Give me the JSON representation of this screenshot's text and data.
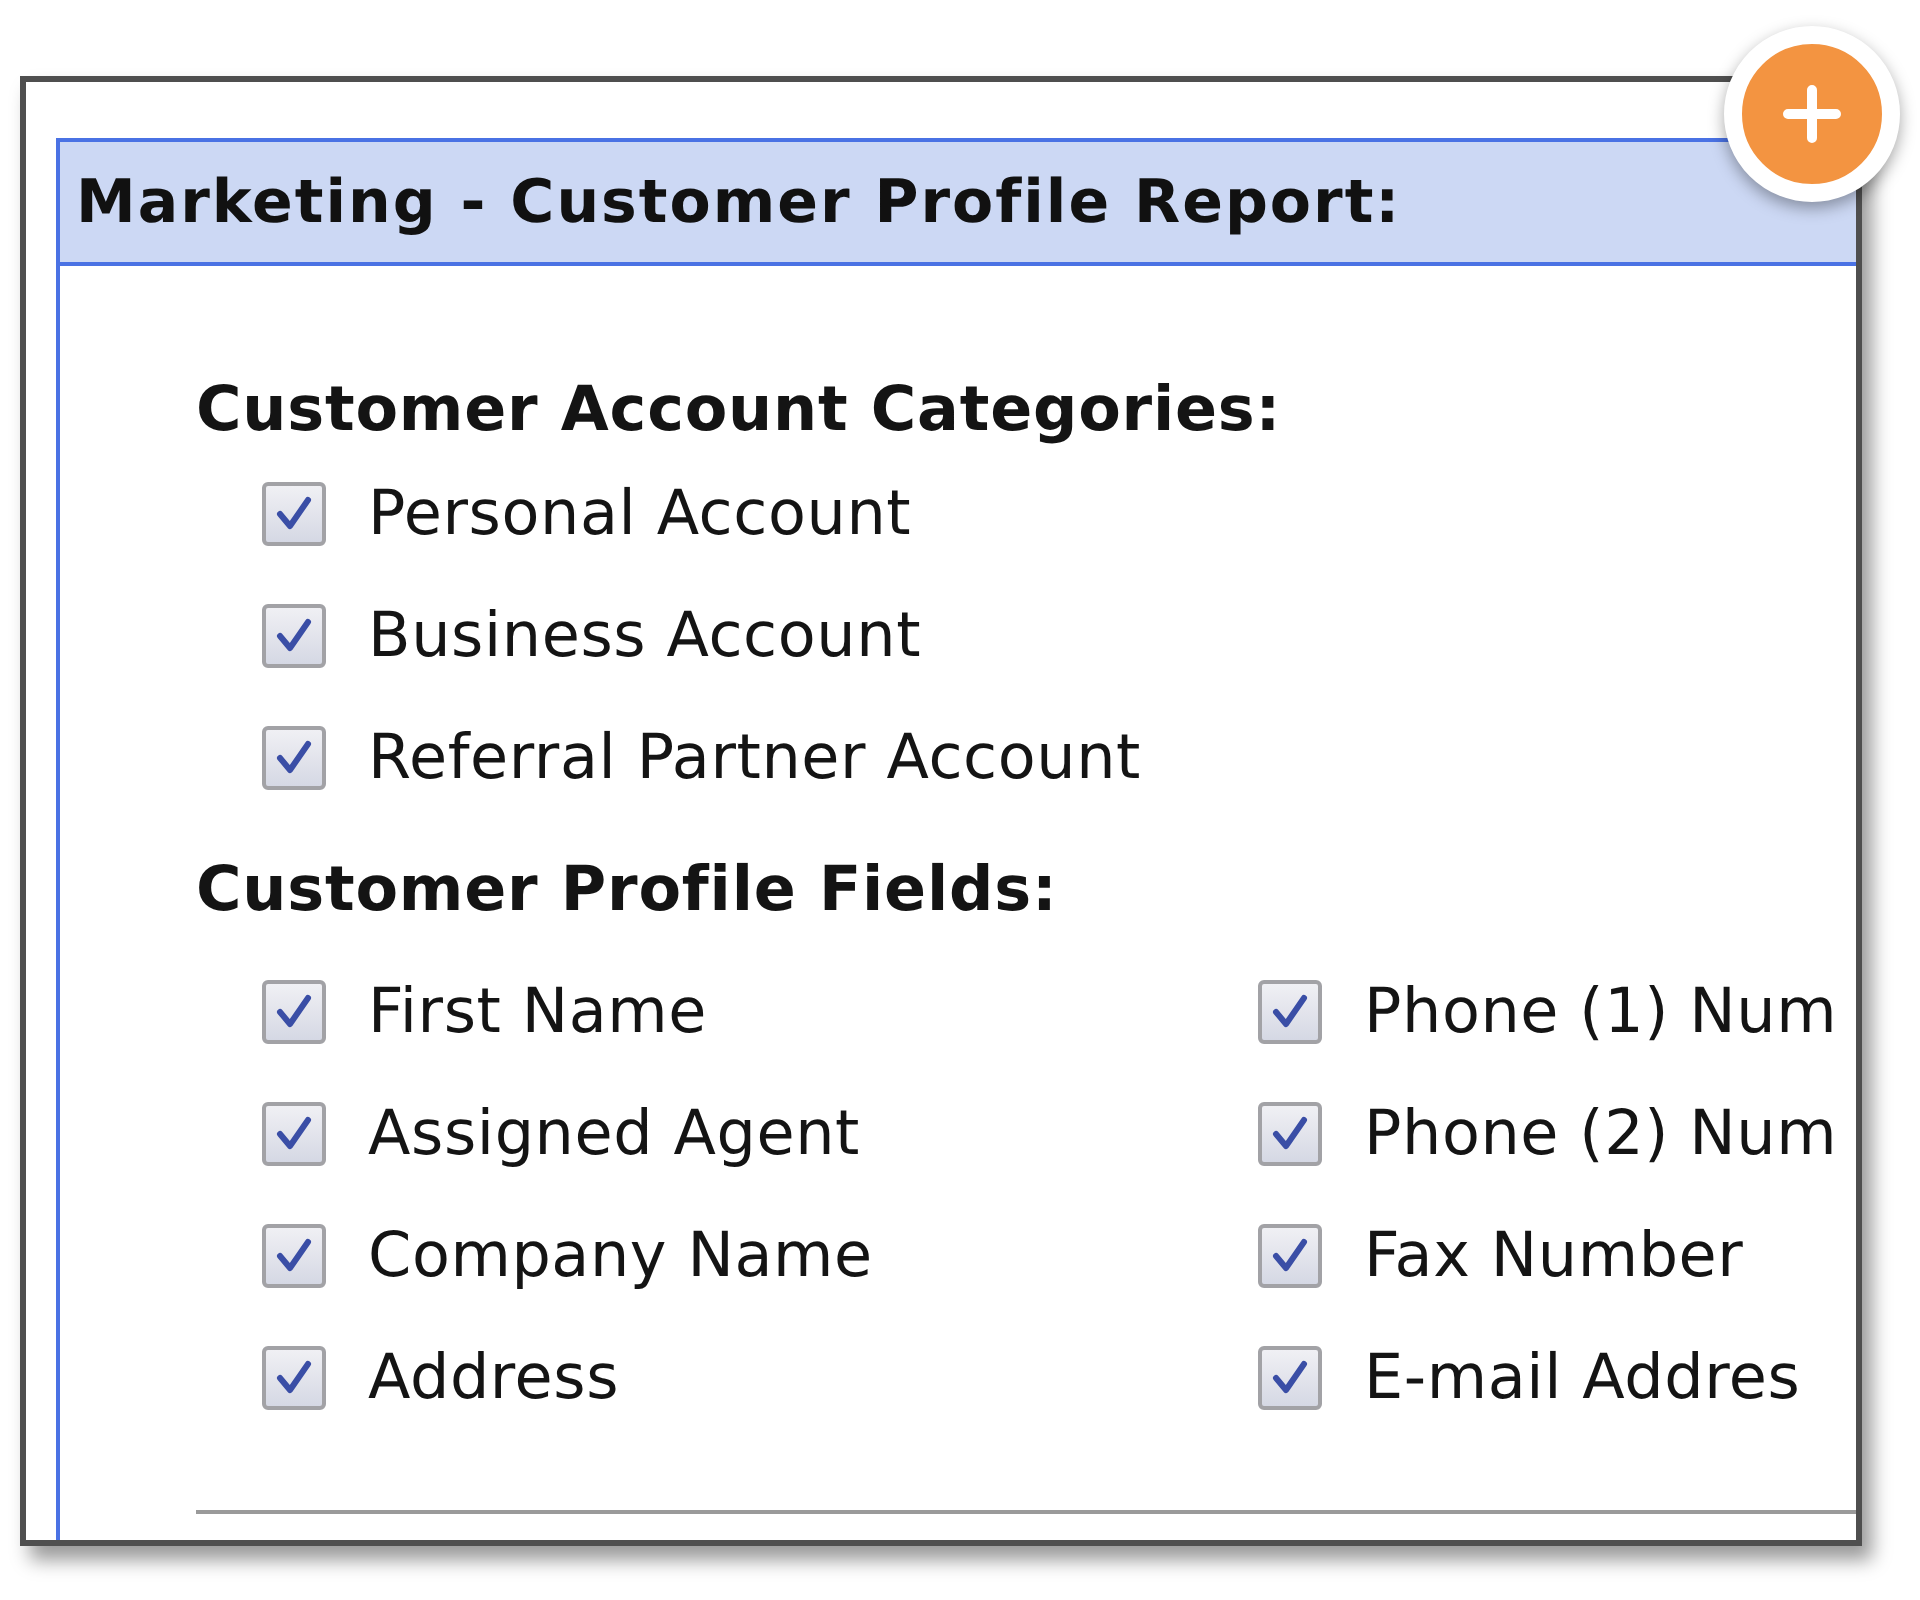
{
  "report": {
    "title": "Marketing - Customer Profile Report:"
  },
  "sections": [
    {
      "heading": "Customer Account Categories:",
      "columns": [
        {
          "items": [
            {
              "label": "Personal Account",
              "checked": true
            },
            {
              "label": "Business Account",
              "checked": true
            },
            {
              "label": "Referral Partner Account",
              "checked": true
            }
          ]
        }
      ]
    },
    {
      "heading": "Customer Profile Fields:",
      "columns": [
        {
          "items": [
            {
              "label": "First Name",
              "checked": true
            },
            {
              "label": "Assigned Agent",
              "checked": true
            },
            {
              "label": "Company Name",
              "checked": true
            },
            {
              "label": "Address",
              "checked": true
            }
          ]
        },
        {
          "items": [
            {
              "label": "Phone (1) Num",
              "checked": true
            },
            {
              "label": "Phone (2) Num",
              "checked": true
            },
            {
              "label": "Fax Number",
              "checked": true
            },
            {
              "label": "E-mail Addres",
              "checked": true
            }
          ]
        }
      ]
    }
  ]
}
